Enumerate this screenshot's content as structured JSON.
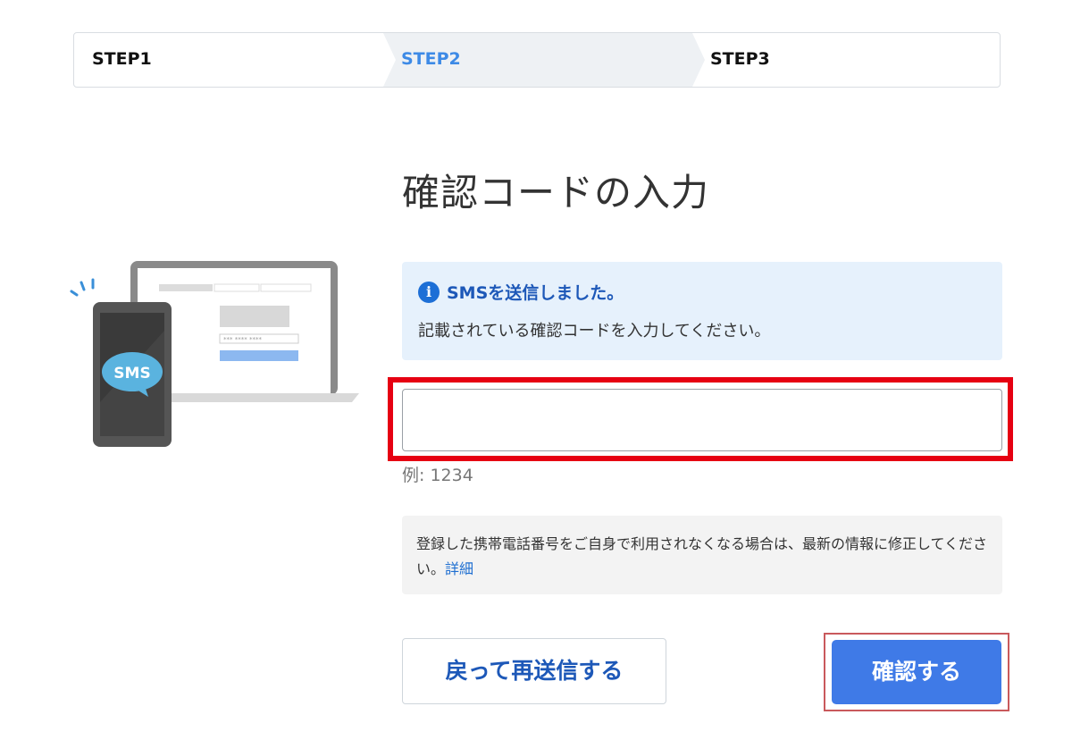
{
  "steps": {
    "step1": "STEP1",
    "step2": "STEP2",
    "step3": "STEP3"
  },
  "title": "確認コードの入力",
  "illustration": {
    "sms_badge": "SMS"
  },
  "info": {
    "icon": "info-icon",
    "heading": "SMSを送信しました。",
    "body": "記載されている確認コードを入力してください。"
  },
  "code_input": {
    "value": "",
    "placeholder": ""
  },
  "example_text": "例: 1234",
  "note": {
    "text": "登録した携帯電話番号をご自身で利用されなくなる場合は、最新の情報に修正してください。",
    "link_label": "詳細"
  },
  "buttons": {
    "resend_label": "戻って再送信する",
    "confirm_label": "確認する"
  },
  "colors": {
    "accent": "#3f7ae7",
    "active_step": "#3d8ae6",
    "highlight_red": "#e60012",
    "info_bg": "#e6f1fc"
  }
}
